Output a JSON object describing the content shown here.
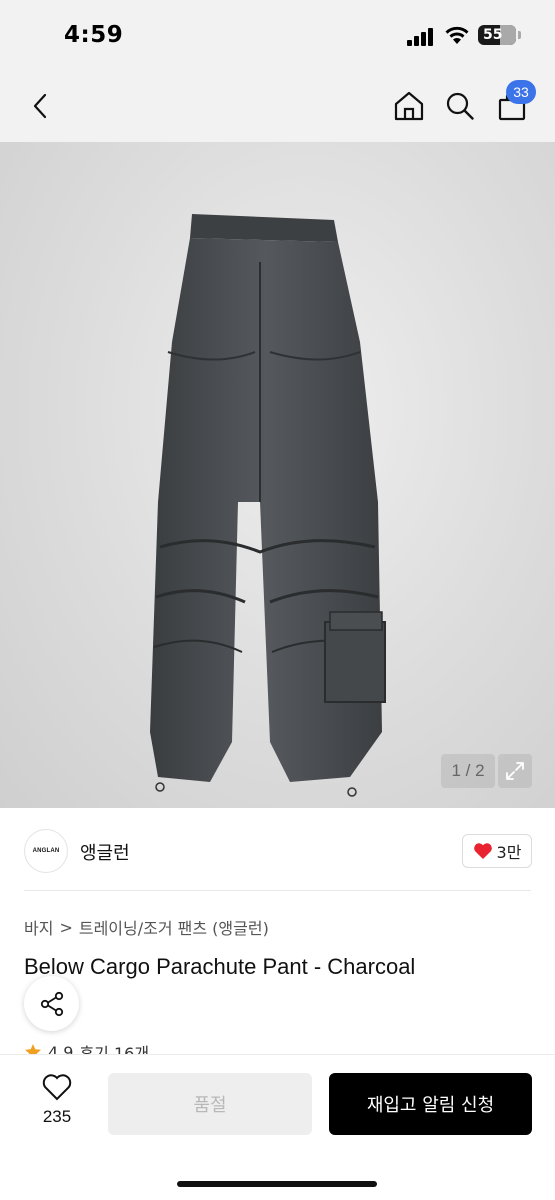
{
  "status_bar": {
    "time": "4:59",
    "battery": "55"
  },
  "header": {
    "cart_count": "33"
  },
  "gallery": {
    "counter": "1 / 2"
  },
  "brand": {
    "logo_text": "ANGLAN",
    "name": "앵글런",
    "likes": "3만"
  },
  "breadcrumb": {
    "category": "바지",
    "separator": ">",
    "subcategory": "트레이닝/조거 팬츠 (앵글런)"
  },
  "product": {
    "title": "Below Cargo Parachute Pant - Charcoal",
    "rating": "4.9",
    "reviews": "후기 16개"
  },
  "bottom_bar": {
    "wishlist_count": "235",
    "soldout_label": "품절",
    "restock_label": "재입고 알림 신청"
  },
  "colors": {
    "accent_blue": "#3b73e8",
    "like_red": "#e8232f",
    "star_orange": "#f0a020"
  }
}
